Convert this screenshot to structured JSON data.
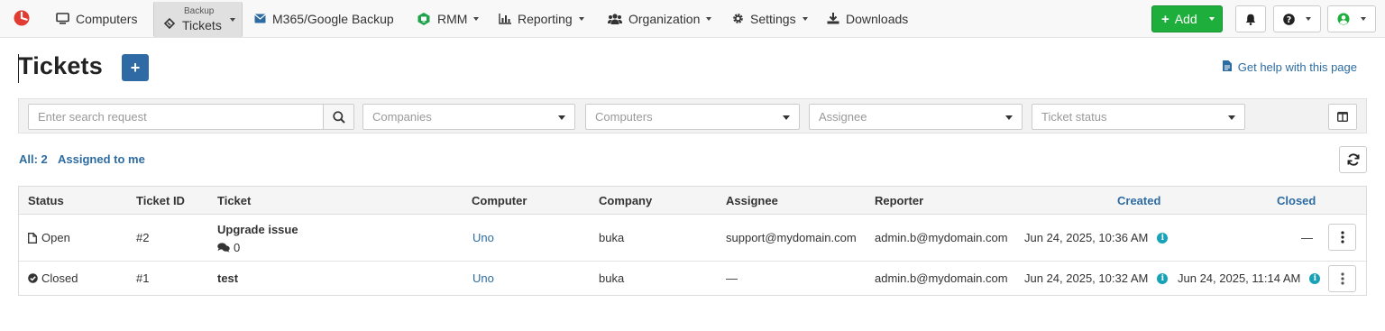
{
  "nav": {
    "computers": "Computers",
    "backup_small": "Backup",
    "backup_big": "Tickets",
    "m365": "M365/Google Backup",
    "rmm": "RMM",
    "reporting": "Reporting",
    "organization": "Organization",
    "settings": "Settings",
    "downloads": "Downloads",
    "add": "Add"
  },
  "header": {
    "title": "Tickets",
    "help": "Get help with this page"
  },
  "filters": {
    "search_placeholder": "Enter search request",
    "companies": "Companies",
    "computers": "Computers",
    "assignee": "Assignee",
    "status": "Ticket status"
  },
  "counters": {
    "all": "All: 2",
    "assigned": "Assigned to me"
  },
  "table": {
    "headers": {
      "status": "Status",
      "ticket_id": "Ticket ID",
      "ticket": "Ticket",
      "computer": "Computer",
      "company": "Company",
      "assignee": "Assignee",
      "reporter": "Reporter",
      "created": "Created",
      "closed": "Closed"
    },
    "rows": [
      {
        "status": "Open",
        "id": "#2",
        "ticket": "Upgrade issue",
        "comments": "0",
        "computer": "Uno",
        "company": "buka",
        "assignee": "support@mydomain.com",
        "reporter": "admin.b@mydomain.com",
        "created": "Jun 24, 2025, 10:36 AM",
        "closed": "—"
      },
      {
        "status": "Closed",
        "id": "#1",
        "ticket": "test",
        "computer": "Uno",
        "company": "buka",
        "assignee": "—",
        "reporter": "admin.b@mydomain.com",
        "created": "Jun 24, 2025, 10:32 AM",
        "closed": "Jun 24, 2025, 11:14 AM"
      }
    ]
  },
  "colors": {
    "accent": "#2d6ca2",
    "add_green": "#1eae3c",
    "info": "#17a2b8",
    "logo": "#e03c31"
  }
}
